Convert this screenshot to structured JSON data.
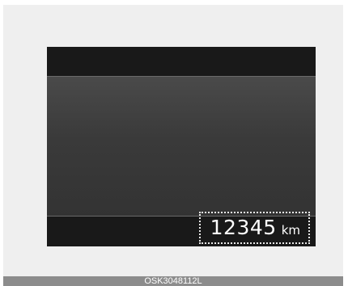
{
  "odometer": {
    "value": "12345",
    "unit": "km"
  },
  "caption": {
    "code": "OSK3048112L"
  },
  "colors": {
    "background": "#efefef",
    "display_dark": "#191919",
    "display_main": "#3a3a3a",
    "text": "#ffffff",
    "caption_bar": "#8c8c8c"
  }
}
